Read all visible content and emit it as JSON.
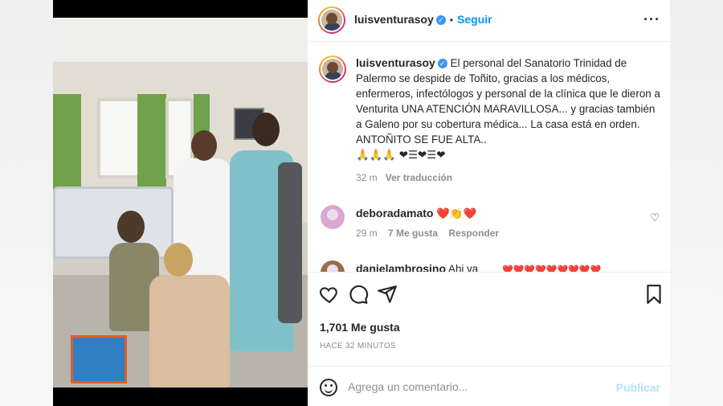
{
  "post": {
    "username": "luisventurasoy",
    "verified_icon": "verified-badge-icon",
    "separator": "•",
    "follow_label": "Seguir",
    "more_icon": "more-options-icon",
    "caption": {
      "username": "luisventurasoy",
      "text": "El personal del Sanatorio Trinidad de Palermo se despide de Toñito, gracias a los médicos, enfermeros, infectólogos y personal de la clínica que le dieron a Venturita UNA ATENCIÓN MARAVILLOSA... y gracias también a Galeno por su cobertura médica... La casa está en orden. ANTOÑITO SE FUE ALTA..",
      "emojis": "🙏🙏🙏 ❤☰❤☰❤",
      "age": "32 m",
      "translate_label": "Ver traducción"
    },
    "comments": [
      {
        "username": "deboradamato",
        "text": "❤️👏❤️",
        "age": "29 m",
        "likes": "7 Me gusta",
        "reply_label": "Responder"
      },
      {
        "username": "danielambrosino",
        "text": "Ahi va",
        "emojis": "❤️❤️❤️❤️❤️❤️❤️❤️❤️"
      }
    ],
    "likes": "1,701 Me gusta",
    "time_ago": "HACE 32 MINUTOS",
    "add_comment_placeholder": "Agrega un comentario...",
    "publish_label": "Publicar"
  },
  "colors": {
    "link_blue": "#0095f6",
    "publish_disabled": "#b2dffc",
    "muted": "#8e8e8e"
  }
}
